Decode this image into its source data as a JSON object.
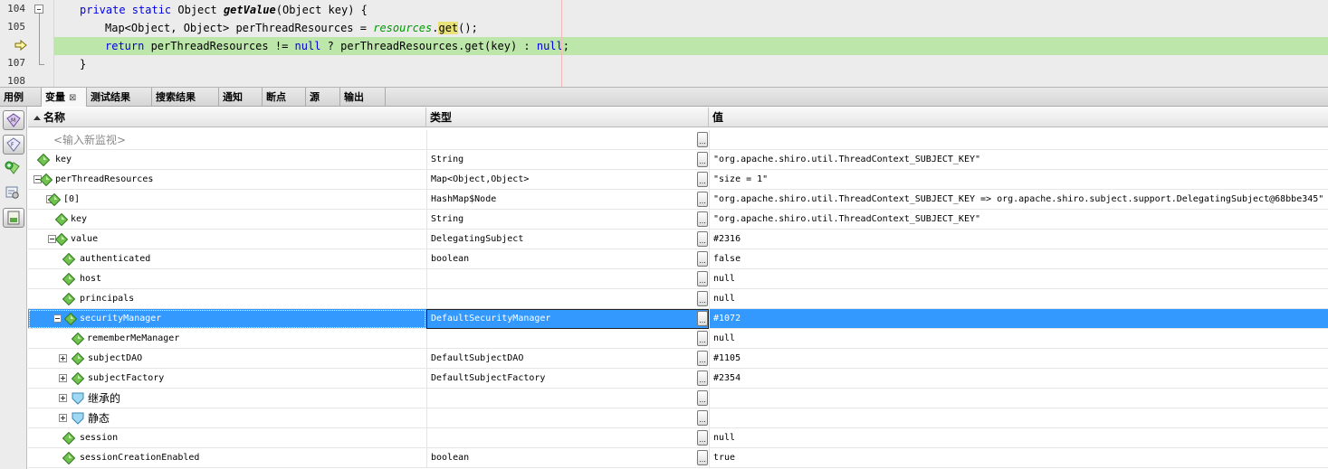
{
  "editor": {
    "lines": [
      {
        "num": "104",
        "kind": "code"
      },
      {
        "num": "105",
        "kind": "code"
      },
      {
        "num": "",
        "kind": "current"
      },
      {
        "num": "107",
        "kind": "code"
      },
      {
        "num": "108",
        "kind": "code"
      }
    ],
    "code": {
      "l104_kw": "private static",
      "l104_mid": " Object ",
      "l104_fn": "getValue",
      "l104_end": "(Object key) {",
      "l105_start": "Map<Object, Object> perThreadResources = ",
      "l105_field": "resources",
      "l105_dot": ".",
      "l105_get": "get",
      "l105_end": "();",
      "l106_ret": "return",
      "l106_mid": " perThreadResources != ",
      "l106_null1": "null",
      "l106_end": " ? perThreadResources.get(key) : ",
      "l106_null2": "null",
      "l106_semi": ";",
      "l107": "}"
    },
    "highlight_color": "#bde6aa"
  },
  "tabs": [
    {
      "label": "用例"
    },
    {
      "label": "变量",
      "active": true,
      "close": "⊠"
    },
    {
      "label": "测试结果"
    },
    {
      "label": "搜索结果"
    },
    {
      "label": "通知"
    },
    {
      "label": "断点"
    },
    {
      "label": "源"
    },
    {
      "label": "输出"
    }
  ],
  "toolbar": {
    "buttons": [
      "watch-icon",
      "evaluate-icon",
      "new-watch-icon",
      "settings-icon",
      "layout-icon"
    ]
  },
  "table": {
    "columns": {
      "name": "名称",
      "type": "类型",
      "value": "值"
    },
    "dots_label": "...",
    "selected_color": "#3399ff",
    "rows": [
      {
        "name": "<输入新监视>",
        "type": "",
        "value": "",
        "kind": "placeholder",
        "icon": "none",
        "expander": "none"
      },
      {
        "name": "key",
        "type": "String",
        "value": "\"org.apache.shiro.util.ThreadContext_SUBJECT_KEY\"",
        "icon": "gem",
        "expander": "none"
      },
      {
        "name": "perThreadResources",
        "type": "Map<Object,Object>",
        "value": "\"size = 1\"",
        "icon": "gem",
        "expander": "minus"
      },
      {
        "name": "[0]",
        "type": "HashMap$Node",
        "value": "\"org.apache.shiro.util.ThreadContext_SUBJECT_KEY => org.apache.shiro.subject.support.DelegatingSubject@68bbe345\"",
        "icon": "gem",
        "expander": "minus"
      },
      {
        "name": "key",
        "type": "String",
        "value": "\"org.apache.shiro.util.ThreadContext_SUBJECT_KEY\"",
        "icon": "gem",
        "expander": "none"
      },
      {
        "name": "value",
        "type": "DelegatingSubject",
        "value": "#2316",
        "icon": "gem",
        "expander": "minus"
      },
      {
        "name": "authenticated",
        "type": "boolean",
        "value": "false",
        "icon": "gem",
        "expander": "none"
      },
      {
        "name": "host",
        "type": "",
        "value": "null",
        "icon": "gem",
        "expander": "none"
      },
      {
        "name": "principals",
        "type": "",
        "value": "null",
        "icon": "gem",
        "expander": "none"
      },
      {
        "name": "securityManager",
        "type": "DefaultSecurityManager",
        "value": "#1072",
        "icon": "gem",
        "expander": "minus",
        "selected": true
      },
      {
        "name": "rememberMeManager",
        "type": "",
        "value": "null",
        "icon": "gem",
        "expander": "none"
      },
      {
        "name": "subjectDAO",
        "type": "DefaultSubjectDAO",
        "value": "#1105",
        "icon": "gem",
        "expander": "plus"
      },
      {
        "name": "subjectFactory",
        "type": "DefaultSubjectFactory",
        "value": "#2354",
        "icon": "gem",
        "expander": "plus"
      },
      {
        "name": "继承的",
        "type": "",
        "value": "",
        "icon": "shield",
        "expander": "plus",
        "cjk": true
      },
      {
        "name": "静态",
        "type": "",
        "value": "",
        "icon": "shield",
        "expander": "plus",
        "cjk": true
      },
      {
        "name": "session",
        "type": "",
        "value": "null",
        "icon": "gem",
        "expander": "none"
      },
      {
        "name": "sessionCreationEnabled",
        "type": "boolean",
        "value": "true",
        "icon": "gem",
        "expander": "none"
      }
    ]
  }
}
